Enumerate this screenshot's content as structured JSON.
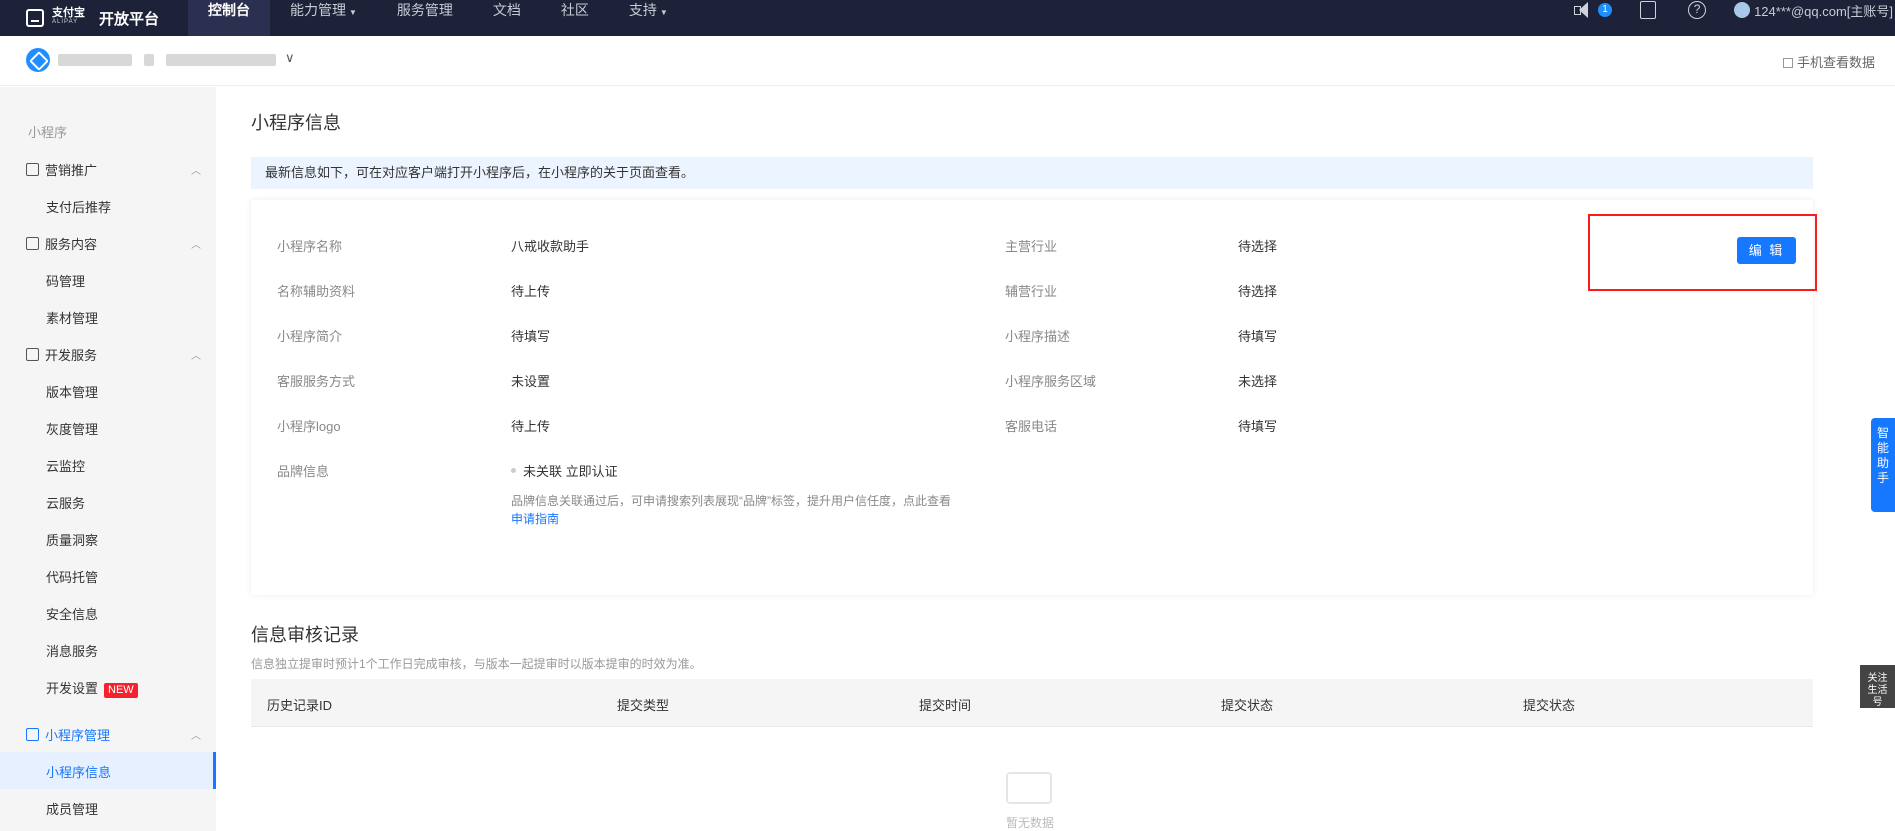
{
  "topbar": {
    "logo_cn": "支付宝",
    "logo_en": "ALIPAY",
    "title": "开放平台",
    "nav": [
      {
        "label": "控制台",
        "caret": false
      },
      {
        "label": "能力管理",
        "caret": true
      },
      {
        "label": "服务管理",
        "caret": false
      },
      {
        "label": "文档",
        "caret": false
      },
      {
        "label": "社区",
        "caret": false
      },
      {
        "label": "支持",
        "caret": true
      }
    ],
    "notification_count": "1",
    "account": "124***@qq.com[主账号]"
  },
  "appbar": {
    "mobile_data_label": "手机查看数据"
  },
  "sidebar": {
    "section_title": "小程序",
    "groups": [
      {
        "label": "营销推广",
        "items": [
          "支付后推荐"
        ]
      },
      {
        "label": "服务内容",
        "items": [
          "码管理",
          "素材管理"
        ]
      },
      {
        "label": "开发服务",
        "items": [
          "版本管理",
          "灰度管理",
          "云监控",
          "云服务",
          "质量洞察",
          "代码托管",
          "安全信息",
          "消息服务",
          "开发设置"
        ]
      },
      {
        "label": "小程序管理",
        "items": [
          "小程序信息",
          "成员管理"
        ]
      }
    ],
    "new_badge": "NEW"
  },
  "main": {
    "title": "小程序信息",
    "notice": "最新信息如下，可在对应客户端打开小程序后，在小程序的关于页面查看。",
    "edit_button": "编 辑",
    "left_fields": [
      {
        "label": "小程序名称",
        "value": "八戒收款助手"
      },
      {
        "label": "名称辅助资料",
        "value": "待上传"
      },
      {
        "label": "小程序简介",
        "value": "待填写"
      },
      {
        "label": "客服服务方式",
        "value": "未设置"
      },
      {
        "label": "小程序logo",
        "value": "待上传"
      },
      {
        "label": "品牌信息",
        "value": "未关联 立即认证"
      }
    ],
    "right_fields": [
      {
        "label": "主营行业",
        "value": "待选择"
      },
      {
        "label": "辅营行业",
        "value": "待选择"
      },
      {
        "label": "小程序描述",
        "value": "待填写"
      },
      {
        "label": "小程序服务区域",
        "value": "未选择"
      },
      {
        "label": "客服电话",
        "value": "待填写"
      }
    ],
    "brand_note": "品牌信息关联通过后，可申请搜索列表展现“品牌”标签，提升用户信任度，点此查看",
    "brand_link": "申请指南",
    "audit_title": "信息审核记录",
    "audit_note": "信息独立提审时预计1个工作日完成审核，与版本一起提审时以版本提审的时效为准。",
    "table_headers": [
      "历史记录ID",
      "提交类型",
      "提交时间",
      "提交状态",
      "提交状态"
    ],
    "empty_text": "暂无数据"
  },
  "floats": {
    "assistant": "智能助手",
    "follow": "关注生活号"
  }
}
